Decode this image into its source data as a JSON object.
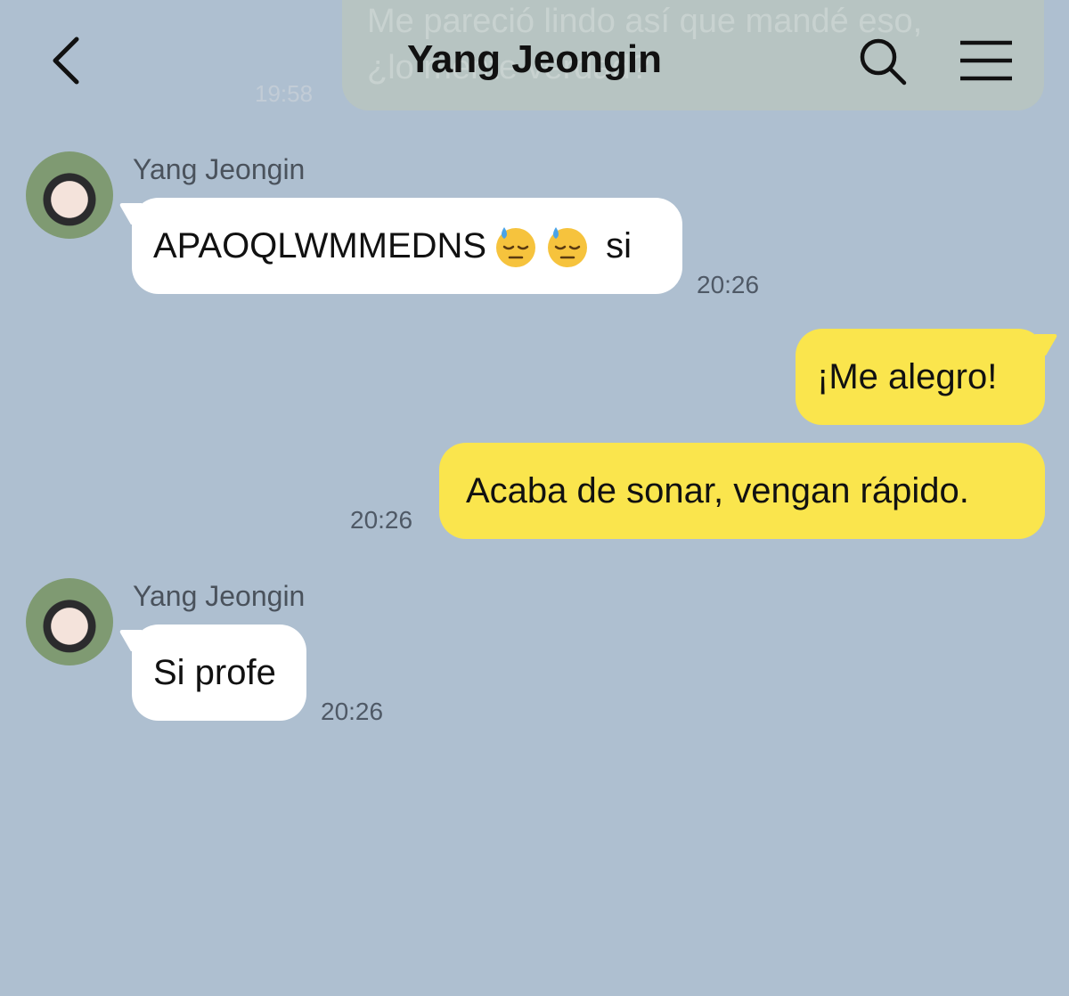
{
  "header": {
    "title": "Yang Jeongin",
    "back_icon": "chevron-left-icon",
    "search_icon": "search-icon",
    "menu_icon": "hamburger-menu-icon"
  },
  "previous_message": {
    "text": "Me pareció lindo así que mandé eso,\n¿lo mente verdad?",
    "time": "19:58"
  },
  "messages": [
    {
      "direction": "in",
      "sender": "Yang Jeongin",
      "text": "APAOQLWMMEDNS",
      "trailing_text": "si",
      "emoji": [
        "downcast-face-with-sweat-emoji",
        "downcast-face-with-sweat-emoji"
      ],
      "time": "20:26"
    },
    {
      "direction": "out",
      "text": "¡Me alegro!"
    },
    {
      "direction": "out",
      "text": "Acaba de sonar, vengan rápido.",
      "time": "20:26"
    },
    {
      "direction": "in",
      "sender": "Yang Jeongin",
      "text": "Si profe",
      "time": "20:26"
    }
  ],
  "colors": {
    "background": "#aebfd0",
    "outgoing_bubble": "#fae54d",
    "incoming_bubble": "#ffffff"
  }
}
